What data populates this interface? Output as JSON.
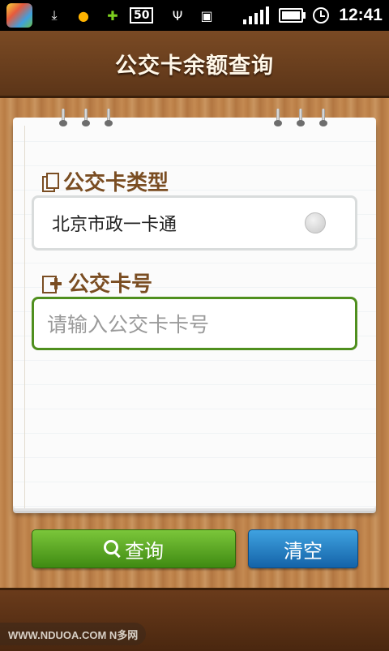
{
  "status_bar": {
    "time": "12:41",
    "icons": [
      "app-launcher-icon",
      "download-icon",
      "qq-icon",
      "360-plus-icon",
      "50-badge-icon",
      "usb-icon",
      "android-icon",
      "signal-icon",
      "battery-icon",
      "alarm-icon"
    ],
    "badge_text": "50"
  },
  "header": {
    "title": "公交卡余额查询"
  },
  "form": {
    "card_type": {
      "label": "公交卡类型",
      "value": "北京市政一卡通"
    },
    "card_number": {
      "label": "公交卡号",
      "placeholder": "请输入公交卡卡号",
      "value": ""
    }
  },
  "actions": {
    "query_label": "查询",
    "clear_label": "清空"
  },
  "footer": {
    "watermark": "WWW.NDUOA.COM N多网"
  },
  "colors": {
    "header_bg": "#5c3518",
    "input_border": "#4f8f1e",
    "query_btn": "#3f8a12",
    "clear_btn": "#1463a8",
    "label_text": "#7a4d22"
  }
}
